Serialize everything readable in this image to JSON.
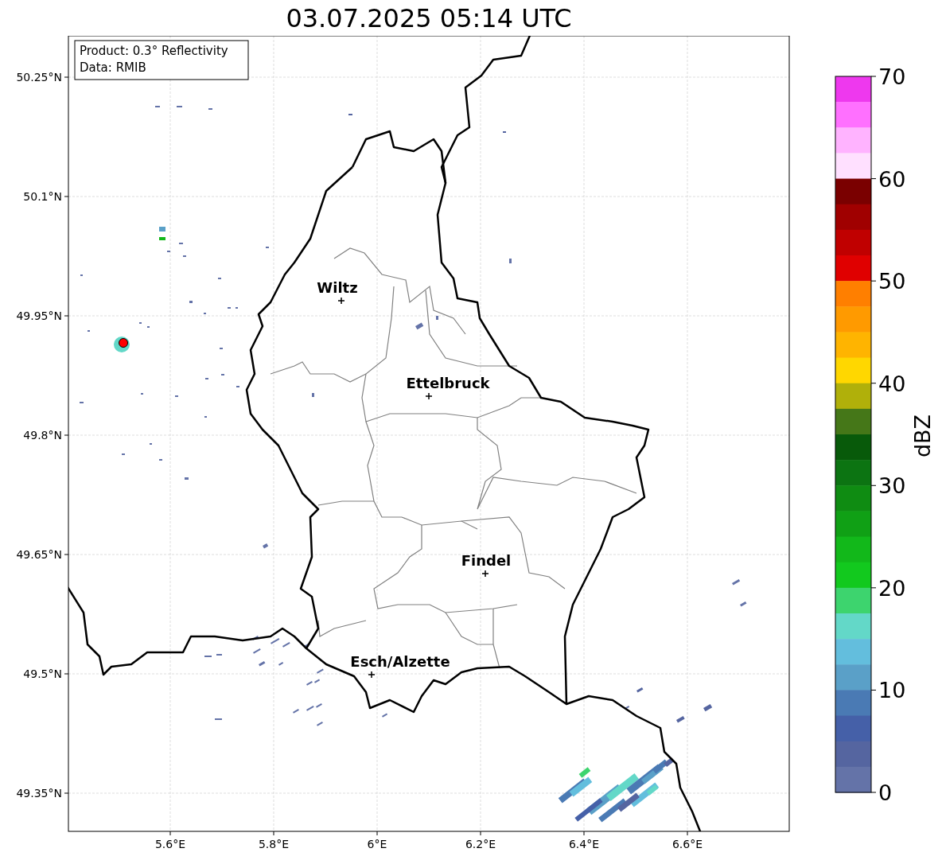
{
  "figure": {
    "title": "03.07.2025 05:14 UTC"
  },
  "map": {
    "info_lines": [
      "Product: 0.3° Reflectivity",
      "Data: RMIB"
    ],
    "y_tick_labels": [
      "50.25°N",
      "50.1°N",
      "49.95°N",
      "49.8°N",
      "49.65°N",
      "49.5°N",
      "49.35°N"
    ],
    "x_tick_labels": [
      "5.6°E",
      "5.8°E",
      "6°E",
      "6.2°E",
      "6.4°E",
      "6.6°E"
    ],
    "cities": [
      {
        "name": "Wiltz"
      },
      {
        "name": "Ettelbruck"
      },
      {
        "name": "Findel"
      },
      {
        "name": "Esch/Alzette"
      }
    ]
  },
  "colorbar": {
    "label": "dBZ",
    "tick_labels": [
      "70",
      "60",
      "50",
      "40",
      "30",
      "20",
      "10",
      "0"
    ],
    "bins": [
      {
        "color": "#ee38ee"
      },
      {
        "color": "#ff70ff"
      },
      {
        "color": "#ffb3ff"
      },
      {
        "color": "#ffe0ff"
      },
      {
        "color": "#7a0000"
      },
      {
        "color": "#a00000"
      },
      {
        "color": "#c00000"
      },
      {
        "color": "#e00000"
      },
      {
        "color": "#ff7f00"
      },
      {
        "color": "#ff9a00"
      },
      {
        "color": "#ffb400"
      },
      {
        "color": "#ffd700"
      },
      {
        "color": "#b0b00a"
      },
      {
        "color": "#457718"
      },
      {
        "color": "#085a0a"
      },
      {
        "color": "#0c7412"
      },
      {
        "color": "#0f8c12"
      },
      {
        "color": "#10a015"
      },
      {
        "color": "#12b81a"
      },
      {
        "color": "#12c91e"
      },
      {
        "color": "#3dd46e"
      },
      {
        "color": "#63d8c8"
      },
      {
        "color": "#63bedd"
      },
      {
        "color": "#5aa0c8"
      },
      {
        "color": "#4a7ab4"
      },
      {
        "color": "#4560a8"
      },
      {
        "color": "#5565a0"
      },
      {
        "color": "#6473a8"
      }
    ]
  }
}
